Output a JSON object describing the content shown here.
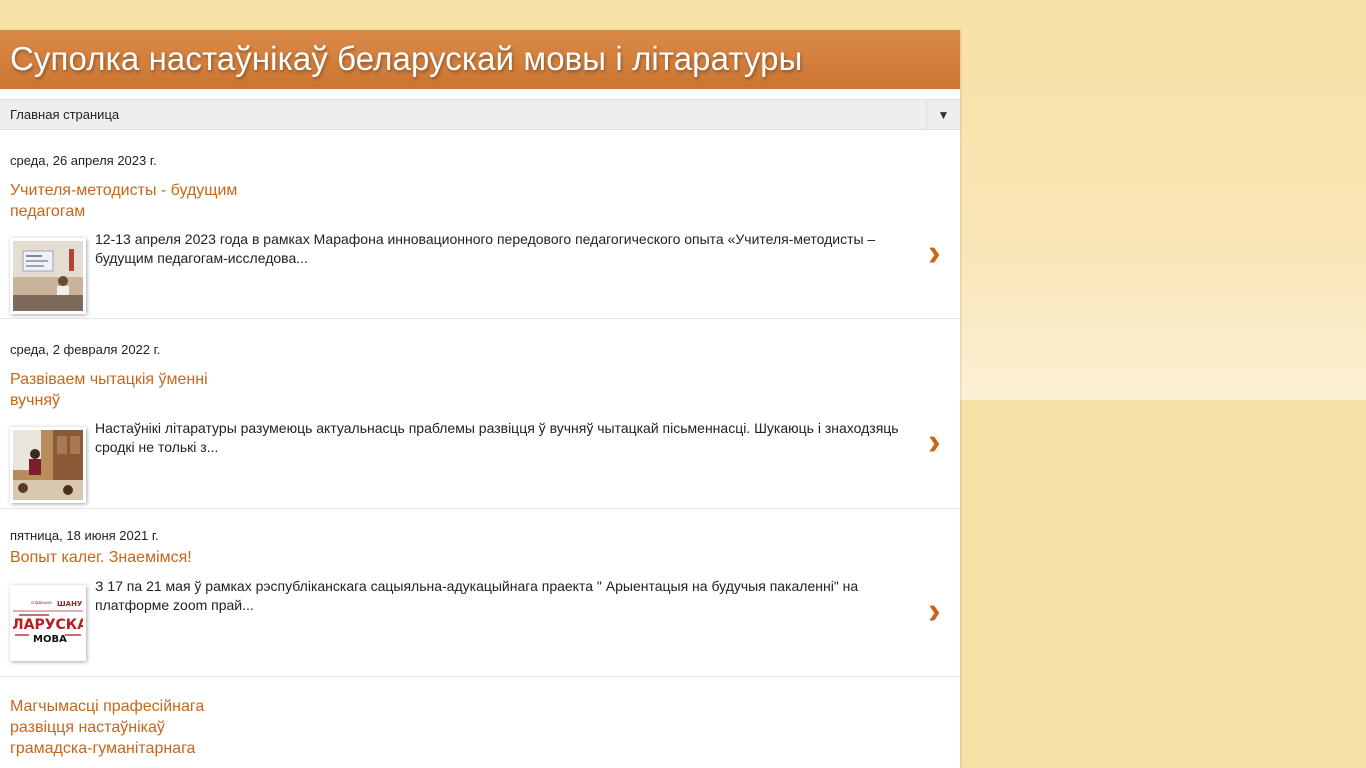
{
  "blog": {
    "title": "Суполка настаўнікаў беларускай мовы і літаратуры"
  },
  "nav": {
    "label": "Главная страница",
    "dropdown_icon": "▼"
  },
  "posts": [
    {
      "date": "среда, 26 апреля 2023 г.",
      "title": "Учителя-методисты - будущим педагогам",
      "snippet": "  12-13 апреля 2023 года  в рамках Марафона инновационного передового педагогического опыта «Учителя-методисты – будущим педагогам-исследова...",
      "chevron": "›"
    },
    {
      "date": "среда, 2 февраля 2022 г.",
      "title": "Развіваем чытацкія ўменні вучняў",
      "snippet": "      Настаўнікі літаратуры разумеюць актуальнасць праблемы развіцця ў вучняў чытацкай пісьменнасці. Шукаюць і знаходзяць сродкі не толькі з...",
      "chevron": "›"
    },
    {
      "date": "пятница, 18 июня 2021 г.",
      "title": "Вопыт калег. Знаемімся!",
      "snippet": "З 17 па 21 мая ў рамках рэспубліканскага сацыяльна-адукацыйнага праекта \" Арыентацыя на будучыя пакаленні\"  на платформе zoom прай...",
      "chevron": "›",
      "thumb_text": {
        "main": "ЛАРУСКАЯ",
        "sub": "МОВА",
        "small_1": "ШАНУЙ",
        "small_2": "спадчына"
      }
    },
    {
      "title": "Магчымасці прафесійнага развіцця настаўнікаў грамадска-гуманітарнага"
    }
  ],
  "colors": {
    "accent": "#c7661a",
    "header": "#d27d3c",
    "background": "#f8e1a6"
  }
}
